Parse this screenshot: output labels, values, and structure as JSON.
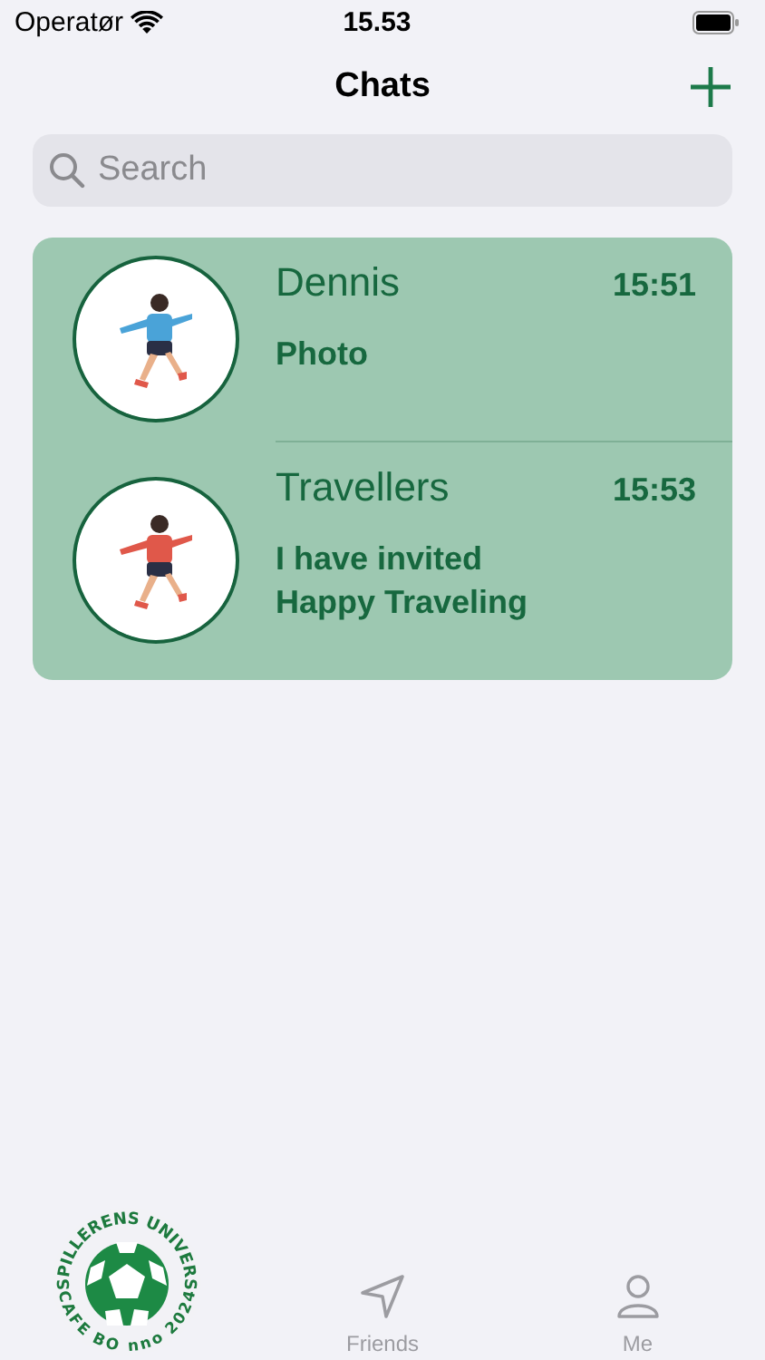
{
  "status_bar": {
    "carrier": "Operatør",
    "time": "15.53"
  },
  "header": {
    "title": "Chats"
  },
  "search": {
    "placeholder": "Search"
  },
  "chats": [
    {
      "name": "Dennis",
      "time": "15:51",
      "preview": "Photo"
    },
    {
      "name": "Travellers",
      "time": "15:53",
      "preview": "I have invited\nHappy Traveling"
    }
  ],
  "tabs": [
    {
      "kind": "logo",
      "selected": true,
      "logo_top": "SPILLERENS UNIVERS",
      "logo_left": "CAFE BO",
      "logo_right": "nno 2024"
    },
    {
      "kind": "friends",
      "label": "Friends",
      "selected": false
    },
    {
      "kind": "me",
      "label": "Me",
      "selected": false
    }
  ]
}
